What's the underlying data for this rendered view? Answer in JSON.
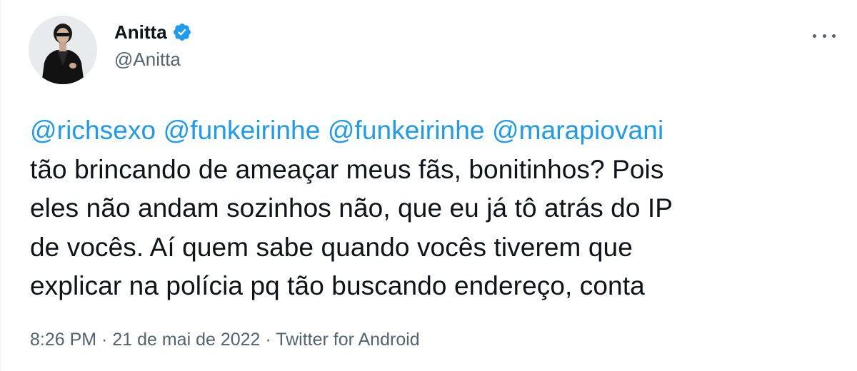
{
  "author": {
    "display_name": "Anitta",
    "handle": "@Anitta",
    "verified": true,
    "avatar_icon": "profile-photo"
  },
  "more_icon": "more-options-icon",
  "tweet": {
    "mentions": [
      "@richsexo",
      "@funkeirinhe",
      "@funkeirinhe",
      "@marapiovani"
    ],
    "lines": [
      "tão brincando de ameaçar meus fãs, bonitinhos? Pois",
      "eles não andam sozinhos não, que eu já tô atrás do IP",
      "de vocês. Aí quem sabe quando vocês tiverem que",
      "explicar na polícia pq tão buscando endereço, conta"
    ]
  },
  "meta": {
    "time": "8:26 PM",
    "separator": " · ",
    "date": "21 de mai de 2022",
    "source": "Twitter for Android"
  },
  "colors": {
    "link": "#1d9bf0",
    "text": "#0f1419",
    "secondary": "#536471"
  }
}
